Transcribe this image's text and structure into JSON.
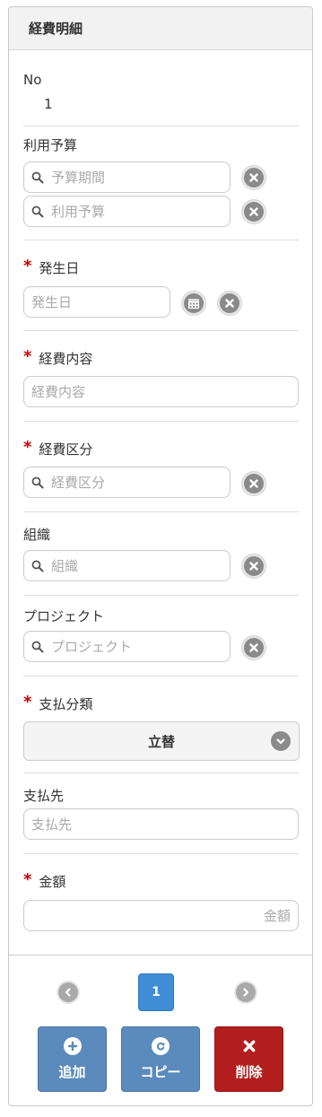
{
  "header": {
    "title": "経費明細"
  },
  "no_field": {
    "label": "No",
    "value": "1"
  },
  "budget": {
    "label": "利用予算",
    "period_placeholder": "予算期間",
    "budget_placeholder": "利用予算"
  },
  "occurrence_date": {
    "label": "発生日",
    "placeholder": "発生日",
    "required": true
  },
  "expense_content": {
    "label": "経費内容",
    "placeholder": "経費内容",
    "required": true
  },
  "expense_category": {
    "label": "経費区分",
    "placeholder": "経費区分",
    "required": true
  },
  "organization": {
    "label": "組織",
    "placeholder": "組織"
  },
  "project": {
    "label": "プロジェクト",
    "placeholder": "プロジェクト"
  },
  "payment_type": {
    "label": "支払分類",
    "selected": "立替",
    "required": true
  },
  "payee": {
    "label": "支払先",
    "placeholder": "支払先"
  },
  "amount": {
    "label": "金額",
    "placeholder": "金額",
    "required": true
  },
  "pager": {
    "current": "1"
  },
  "actions": {
    "add": "追加",
    "copy": "コピー",
    "delete": "削除"
  },
  "required_mark": "*",
  "icons": {
    "search": "search-icon",
    "clear": "clear-icon",
    "calendar": "calendar-icon",
    "chevron": "chevron-down-icon",
    "prev": "prev-icon",
    "next": "next-icon",
    "plus": "plus-icon",
    "copy": "copy-icon",
    "delete": "delete-icon"
  },
  "colors": {
    "accent": "#3f8ed6",
    "button_blue": "#5b8bbc",
    "button_red": "#b31e1e",
    "required": "#c40000"
  }
}
